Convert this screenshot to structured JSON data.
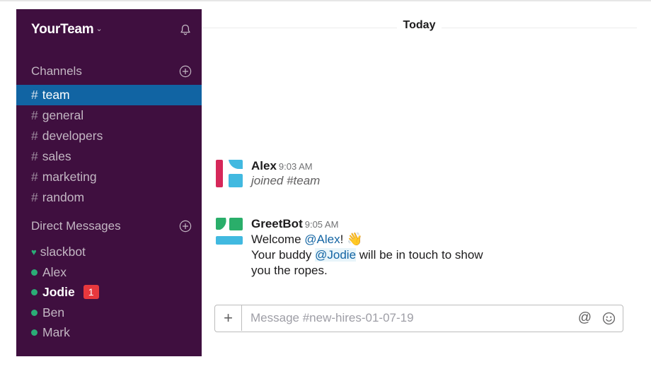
{
  "sidebar": {
    "team_name": "YourTeam",
    "team_caret": "⌄",
    "channels_header": "Channels",
    "channels": [
      {
        "prefix": "#",
        "name": "team",
        "active": true
      },
      {
        "prefix": "#",
        "name": "general"
      },
      {
        "prefix": "#",
        "name": "developers"
      },
      {
        "prefix": "#",
        "name": "sales"
      },
      {
        "prefix": "#",
        "name": "marketing"
      },
      {
        "prefix": "#",
        "name": "random"
      }
    ],
    "dm_header": "Direct Messages",
    "direct_messages": [
      {
        "name": "slackbot",
        "presence": "heart"
      },
      {
        "name": "Alex",
        "presence": "online"
      },
      {
        "name": "Jodie",
        "presence": "online",
        "unread": true,
        "badge": "1"
      },
      {
        "name": "Ben",
        "presence": "online"
      },
      {
        "name": "Mark",
        "presence": "online"
      }
    ],
    "icons": {
      "bell": "bell-icon",
      "add_channel": "plus-circle-icon",
      "add_dm": "plus-circle-icon"
    }
  },
  "main": {
    "day_divider": "Today",
    "messages": [
      {
        "sender": "Alex",
        "timestamp": "9:03 AM",
        "lines": [
          "joined #team"
        ],
        "system": true
      },
      {
        "sender": "GreetBot",
        "timestamp": "9:05 AM",
        "line1_prefix": "Welcome ",
        "line1_mention": "@Alex",
        "line1_suffix": "!",
        "line1_emoji": "👋",
        "line2_prefix": "Your buddy ",
        "line2_mention": "@Jodie",
        "line2_suffix": " will be in touch to show",
        "line3": "you the ropes."
      }
    ],
    "composer": {
      "plus_label": "+",
      "placeholder": "Message #new-hires-01-07-19",
      "value": "",
      "at_label": "@"
    }
  },
  "colors": {
    "sidebar_bg": "#3f0f3f",
    "active_channel": "#1164a3",
    "presence": "#2bac76",
    "badge": "#e8383d",
    "mention": "#1264a3"
  }
}
